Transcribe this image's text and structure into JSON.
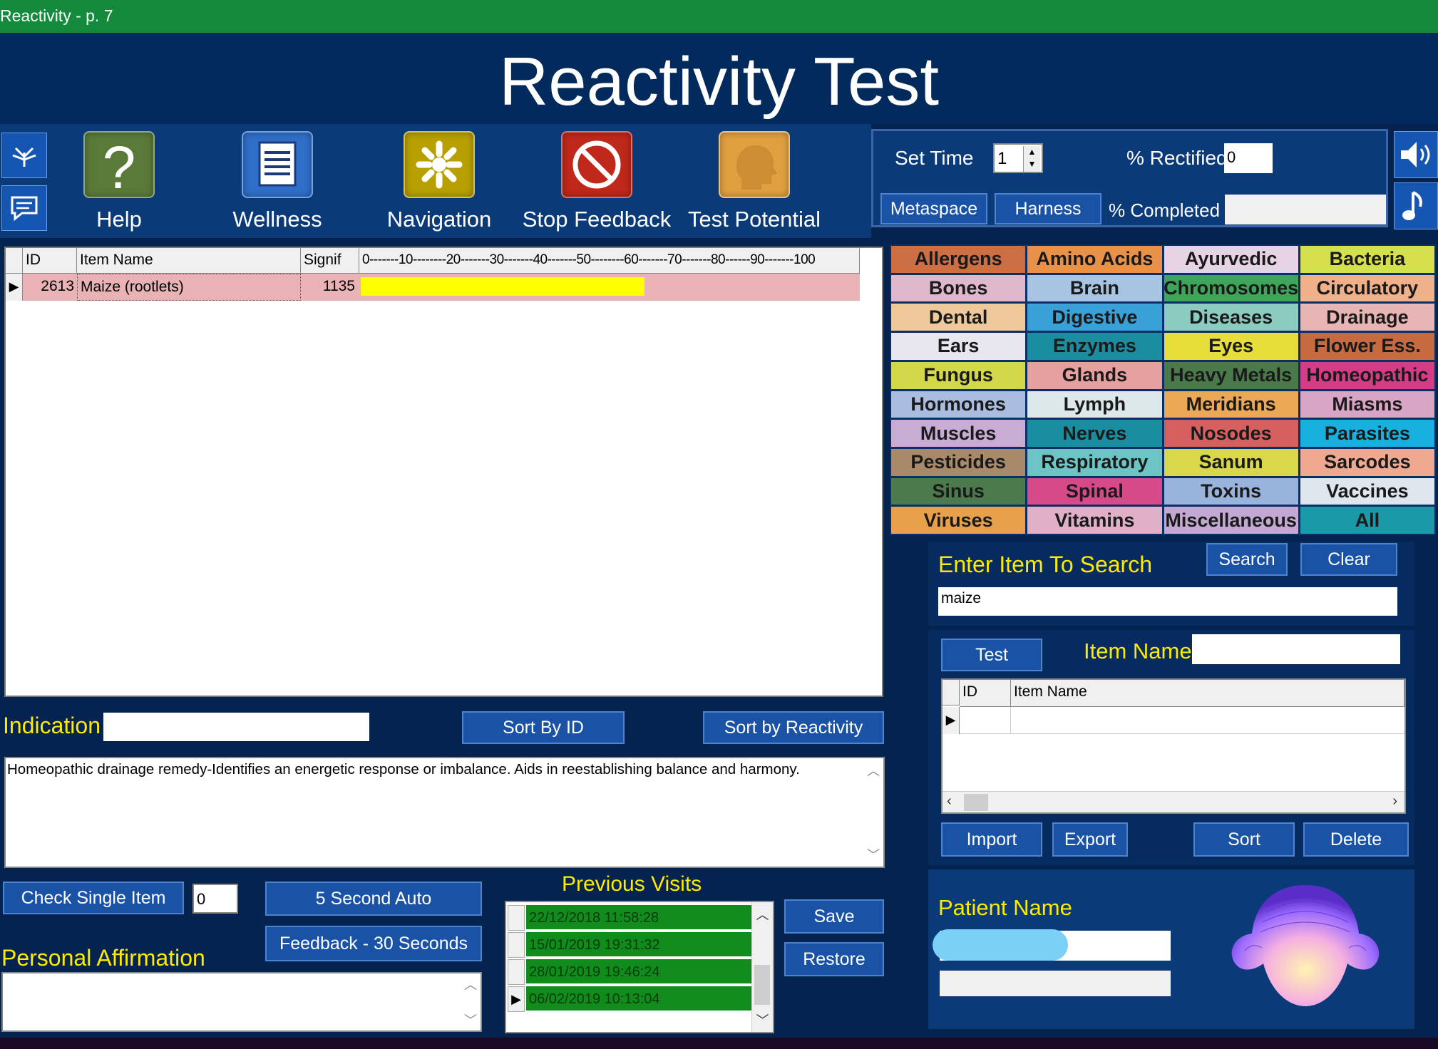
{
  "window": {
    "title": "Reactivity - p. 7"
  },
  "header": {
    "title": "Reactivity Test"
  },
  "toolbar": {
    "buttons": [
      {
        "label": "Help",
        "icon": "question-icon",
        "color": "#5a7a3a"
      },
      {
        "label": "Wellness",
        "icon": "document-icon",
        "color": "#2f6fc9"
      },
      {
        "label": "Navigation",
        "icon": "asterisk-icon",
        "color": "#b8a000"
      },
      {
        "label": "Stop Feedback",
        "icon": "prohibit-icon",
        "color": "#c0281a"
      },
      {
        "label": "Test Potential",
        "icon": "head-icon",
        "color": "#e0a040"
      }
    ]
  },
  "settings": {
    "set_time_label": "Set Time",
    "set_time_value": "1",
    "rectified_label": "% Rectified",
    "rectified_value": "0",
    "completed_label": "% Completed",
    "completed_value": "",
    "metaspace_label": "Metaspace",
    "harness_label": "Harness"
  },
  "grid": {
    "headers": [
      "ID",
      "Item Name",
      "Signif",
      "0-------10--------20-------30-------40-------50--------60-------70-------80------90-------100"
    ],
    "rows": [
      {
        "id": "2613",
        "name": "Maize (rootlets)",
        "signif": "1135",
        "reactivity_percent": 57
      }
    ],
    "bar_color": "#ffff00",
    "row_color": "#e9b2b5"
  },
  "indication": {
    "label": "Indication",
    "value": "",
    "sort_by_id": "Sort By ID",
    "sort_by_reactivity": "Sort by Reactivity",
    "description": "Homeopathic drainage remedy-Identifies an energetic response or imbalance. Aids in reestablishing balance and harmony."
  },
  "bottom": {
    "check_single": "Check Single Item",
    "check_value": "0",
    "five_second": "5 Second Auto",
    "feedback_30": "Feedback - 30 Seconds",
    "affirmation_label": "Personal Affirmation",
    "affirmation_value": ""
  },
  "visits": {
    "label": "Previous Visits",
    "items": [
      "22/12/2018 11:58:28",
      "15/01/2019 19:31:32",
      "28/01/2019 19:46:24",
      "06/02/2019 10:13:04"
    ],
    "save": "Save",
    "restore": "Restore"
  },
  "categories": [
    {
      "label": "Allergens",
      "color": "#cc6f45"
    },
    {
      "label": "Amino Acids",
      "color": "#e8914a"
    },
    {
      "label": "Ayurvedic",
      "color": "#e8d3e6"
    },
    {
      "label": "Bacteria",
      "color": "#d6e04a"
    },
    {
      "label": "Bones",
      "color": "#e0b8cc"
    },
    {
      "label": "Brain",
      "color": "#a7c4e2"
    },
    {
      "label": "Chromosomes",
      "color": "#3fa55a"
    },
    {
      "label": "Circulatory",
      "color": "#f0b089"
    },
    {
      "label": "Dental",
      "color": "#efc89c"
    },
    {
      "label": "Digestive",
      "color": "#3aa0d8"
    },
    {
      "label": "Diseases",
      "color": "#8ccbc0"
    },
    {
      "label": "Drainage",
      "color": "#e9b4b4"
    },
    {
      "label": "Ears",
      "color": "#e8e6ee"
    },
    {
      "label": "Enzymes",
      "color": "#1a8ea0"
    },
    {
      "label": "Eyes",
      "color": "#e8de3a"
    },
    {
      "label": "Flower Ess.",
      "color": "#c86a40"
    },
    {
      "label": "Fungus",
      "color": "#d3d84a"
    },
    {
      "label": "Glands",
      "color": "#e6a0a0"
    },
    {
      "label": "Heavy Metals",
      "color": "#4a7a4a"
    },
    {
      "label": "Homeopathic",
      "color": "#d43c86"
    },
    {
      "label": "Hormones",
      "color": "#a8bde0"
    },
    {
      "label": "Lymph",
      "color": "#dde8ea"
    },
    {
      "label": "Meridians",
      "color": "#eda855"
    },
    {
      "label": "Miasms",
      "color": "#d9a5c4"
    },
    {
      "label": "Muscles",
      "color": "#c9acd4"
    },
    {
      "label": "Nerves",
      "color": "#1a8ea0"
    },
    {
      "label": "Nosodes",
      "color": "#d66060"
    },
    {
      "label": "Parasites",
      "color": "#18b0de"
    },
    {
      "label": "Pesticides",
      "color": "#a88a6a"
    },
    {
      "label": "Respiratory",
      "color": "#6cc4c4"
    },
    {
      "label": "Sanum",
      "color": "#d8d84a"
    },
    {
      "label": "Sarcodes",
      "color": "#efa990"
    },
    {
      "label": "Sinus",
      "color": "#4c7a4c"
    },
    {
      "label": "Spinal",
      "color": "#d64a8a"
    },
    {
      "label": "Toxins",
      "color": "#98b4dc"
    },
    {
      "label": "Vaccines",
      "color": "#dfe6ee"
    },
    {
      "label": "Viruses",
      "color": "#e8a04a"
    },
    {
      "label": "Vitamins",
      "color": "#e0b0c8"
    },
    {
      "label": "Miscellaneous",
      "color": "#c4a8d4"
    },
    {
      "label": "All",
      "color": "#1a9aa8"
    }
  ],
  "search": {
    "label": "Enter Item To Search",
    "value": "maize",
    "search_btn": "Search",
    "clear_btn": "Clear"
  },
  "test_panel": {
    "test_btn": "Test",
    "item_name_label": "Item Name",
    "item_name_value": "",
    "headers": [
      "ID",
      "Item Name"
    ],
    "import": "Import",
    "export": "Export",
    "sort": "Sort",
    "delete": "Delete"
  },
  "patient": {
    "label": "Patient Name",
    "name_value": "",
    "secondary_value": ""
  }
}
